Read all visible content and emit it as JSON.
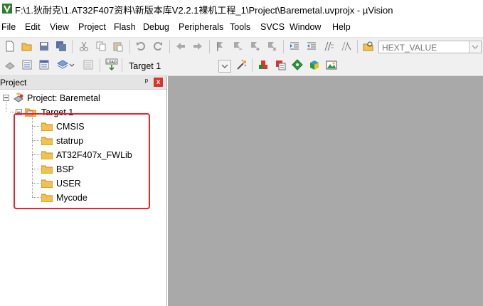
{
  "window": {
    "title": "F:\\1.狄耐克\\1.AT32F407资料\\新版本库V2.2.1裸机工程_1\\Project\\Baremetal.uvprojx - µVision"
  },
  "menu": [
    "File",
    "Edit",
    "View",
    "Project",
    "Flash",
    "Debug",
    "Peripherals",
    "Tools",
    "SVCS",
    "Window",
    "Help"
  ],
  "toolbar": {
    "find_combo_value": "HEXT_VALUE",
    "target_combo_value": "Target 1"
  },
  "panel": {
    "title": "Project",
    "pin": "ᵖ",
    "close": "x"
  },
  "tree": {
    "project": "Project: Baremetal",
    "target": "Target 1",
    "groups": [
      "CMSIS",
      "statrup",
      "AT32F407x_FWLib",
      "BSP",
      "USER",
      "Mycode"
    ]
  },
  "colors": {
    "highlight": "#e8242d",
    "folder": "#f2c14e",
    "workspace": "#a9a9a9"
  }
}
